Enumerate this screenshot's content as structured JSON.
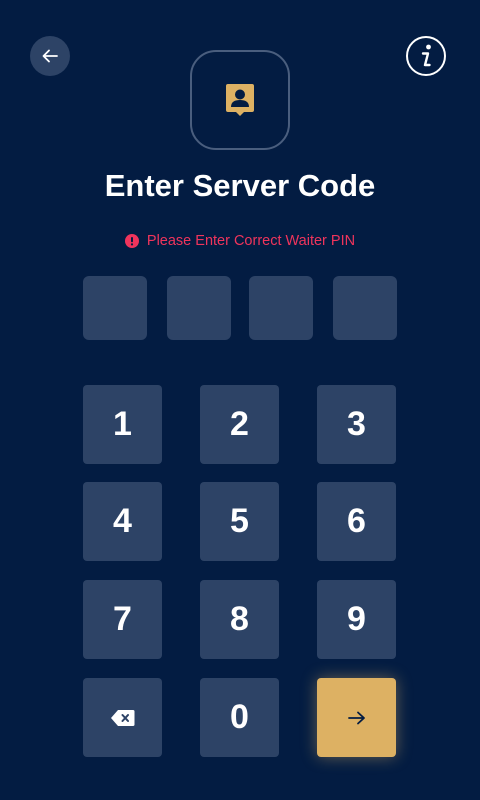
{
  "header": {
    "title": "Enter Server Code",
    "error_message": "Please Enter Correct Waiter PIN"
  },
  "pin": {
    "length": 4,
    "entered": ""
  },
  "keypad": {
    "keys": [
      "1",
      "2",
      "3",
      "4",
      "5",
      "6",
      "7",
      "8",
      "9",
      "0"
    ]
  },
  "icons": {
    "back": "arrow-left-icon",
    "info": "info-icon",
    "logo": "user-badge-icon",
    "error": "alert-circle-icon",
    "backspace": "backspace-icon",
    "submit": "arrow-right-icon"
  },
  "colors": {
    "background": "#031c42",
    "surface": "#2d4366",
    "accent": "#ddb163",
    "error": "#f0345c",
    "text": "#ffffff"
  }
}
